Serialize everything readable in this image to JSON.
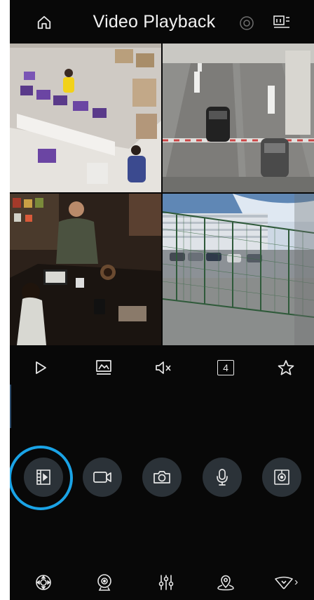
{
  "header": {
    "title": "Video Playback",
    "icons": [
      "home-icon",
      "settings-dial-icon",
      "channel-switch-icon"
    ]
  },
  "video_grid": {
    "cells": [
      {
        "scene": "warehouse packing area"
      },
      {
        "scene": "parking garage entrance"
      },
      {
        "scene": "cafe checkout counter"
      },
      {
        "scene": "outdoor parking lot fence"
      }
    ]
  },
  "toolbar": {
    "layout_count": "4",
    "icons": [
      "play-icon",
      "image-quality-icon",
      "mute-icon",
      "layout-split-icon",
      "favorite-star-icon"
    ]
  },
  "actions": {
    "icons": [
      "video-clip-icon",
      "record-camera-icon",
      "snapshot-icon",
      "microphone-icon",
      "capture-fisheye-icon"
    ]
  },
  "bottom_bar": {
    "icons": [
      "ptz-control-icon",
      "fisheye-view-icon",
      "adjust-sliders-icon",
      "location-icon",
      "more-options-icon"
    ],
    "more_arrow": "›"
  },
  "colors": {
    "background": "#080808",
    "button_bg": "#2b3238",
    "highlight_ring": "#1aa3e6",
    "icon": "#e6e6e6"
  }
}
